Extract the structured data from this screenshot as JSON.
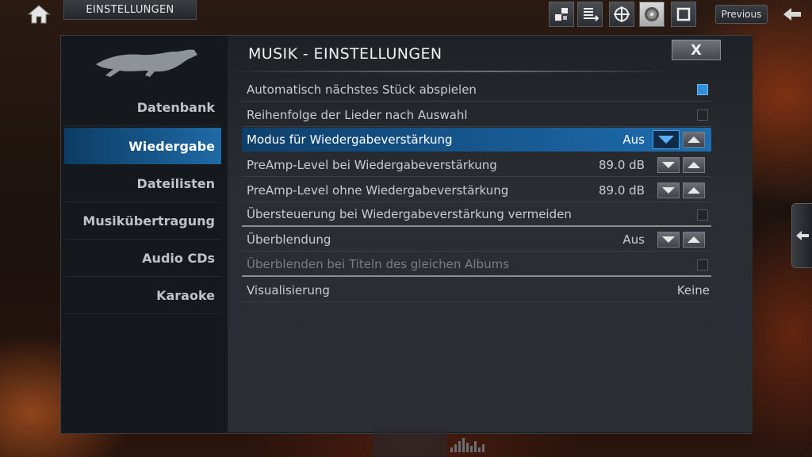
{
  "topbar": {
    "breadcrumb": "EINSTELLUNGEN",
    "previous_label": "Previous"
  },
  "panel": {
    "title": "MUSIK - EINSTELLUNGEN",
    "close_label": "X"
  },
  "sidebar": {
    "items": [
      {
        "label": "Datenbank",
        "active": false
      },
      {
        "label": "Wiedergabe",
        "active": true
      },
      {
        "label": "Dateilisten",
        "active": false
      },
      {
        "label": "Musikübertragung",
        "active": false
      },
      {
        "label": "Audio CDs",
        "active": false
      },
      {
        "label": "Karaoke",
        "active": false
      }
    ]
  },
  "settings": [
    {
      "label": "Automatisch nächstes Stück abspielen",
      "control": "checkbox",
      "checked": true
    },
    {
      "label": "Reihenfolge der Lieder nach Auswahl",
      "control": "checkbox",
      "checked": false
    },
    {
      "label": "Modus für Wiedergabeverstärkung",
      "control": "spinner",
      "value": "Aus",
      "focused": true
    },
    {
      "label": "PreAmp-Level bei Wiedergabeverstärkung",
      "control": "spinner",
      "value": "89.0 dB"
    },
    {
      "label": "PreAmp-Level ohne Wiedergabeverstärkung",
      "control": "spinner",
      "value": "89.0 dB"
    },
    {
      "label": "Übersteuerung bei Wiedergabeverstärkung vermeiden",
      "control": "checkbox",
      "checked": false
    },
    {
      "label": "Überblendung",
      "control": "spinner",
      "value": "Aus"
    },
    {
      "label": "Überblenden bei Titeln des gleichen Albums",
      "control": "checkbox",
      "checked": false,
      "disabled": true
    },
    {
      "label": "Visualisierung",
      "control": "text",
      "value": "Keine"
    }
  ],
  "colors": {
    "accent": "#1e6db0",
    "checkbox_on": "#2f8fd8"
  }
}
